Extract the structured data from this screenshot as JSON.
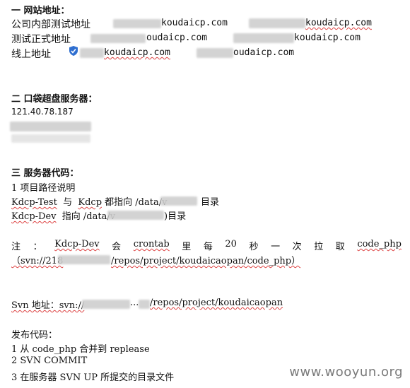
{
  "sec1": {
    "title": "一  网站地址：",
    "rows": [
      {
        "label": "公司内部测试地址",
        "url1": "koudaicp.com",
        "url2": "koudaicp.com"
      },
      {
        "label": "测试正式地址",
        "url1": "oudaicp.com",
        "url2": "koudaicp.com"
      },
      {
        "label": "线上地址",
        "url1": "koudaicp.com",
        "url2": "oudaicp.com"
      }
    ]
  },
  "sec2": {
    "title": "二  口袋超盘服务器：",
    "ip": "121.40.78.187"
  },
  "sec3": {
    "title": "三  服务器代码：",
    "item1": "1 项目路径说明",
    "line_test_a": "Kdcp-Test",
    "line_test_b": "与",
    "line_test_c": "Kdcp",
    "line_test_d": "都指向 /data/v",
    "line_test_e": "目录",
    "line_dev_a": "Kdcp-Dev",
    "line_dev_b": "指向 /data/v",
    "line_dev_c": ")目录",
    "note_words": [
      "注",
      "：",
      "Kdcp-Dev",
      "会",
      "crontab",
      "里",
      "每",
      "20",
      "秒",
      "一",
      "次",
      "拉",
      "取",
      "code_php"
    ],
    "note_line2_a": "（svn://218",
    "note_line2_b": "/repos/project/koudaicaopan/code_php）",
    "svn_label": "Svn 地址：svn://",
    "svn_mid": "...",
    "svn_tail": "/repos/project/koudaicaopan",
    "publish_title": "发布代码：",
    "step1": "1 从 code_php 合并到 replease",
    "step2": "2 SVN COMMIT",
    "step3": "3 在服务器 SVN UP 所提交的目录文件"
  },
  "watermark": "www.wooyun.org"
}
